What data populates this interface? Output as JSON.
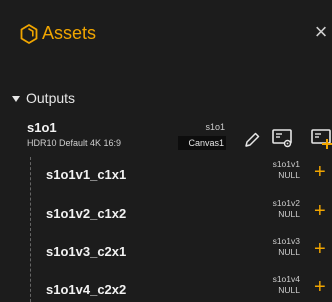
{
  "header": {
    "title": "Assets",
    "icon": "hexagon-outline-icon",
    "close_label": "×"
  },
  "outputs": {
    "label": "Outputs",
    "expanded": true,
    "parent": {
      "name": "s1o1",
      "format": "HDR10 Default 4K 16:9",
      "id": "s1o1",
      "canvas": "Canvas1"
    },
    "children": [
      {
        "name": "s1o1v1_c1x1",
        "id": "s1o1v1",
        "value": "NULL"
      },
      {
        "name": "s1o1v2_c1x2",
        "id": "s1o1v2",
        "value": "NULL"
      },
      {
        "name": "s1o1v3_c2x1",
        "id": "s1o1v3",
        "value": "NULL"
      },
      {
        "name": "s1o1v4_c2x2",
        "id": "s1o1v4",
        "value": "NULL"
      }
    ]
  },
  "colors": {
    "accent": "#f0a500",
    "background": "#1c1c1c",
    "badge_bg": "#0d0d0d"
  }
}
